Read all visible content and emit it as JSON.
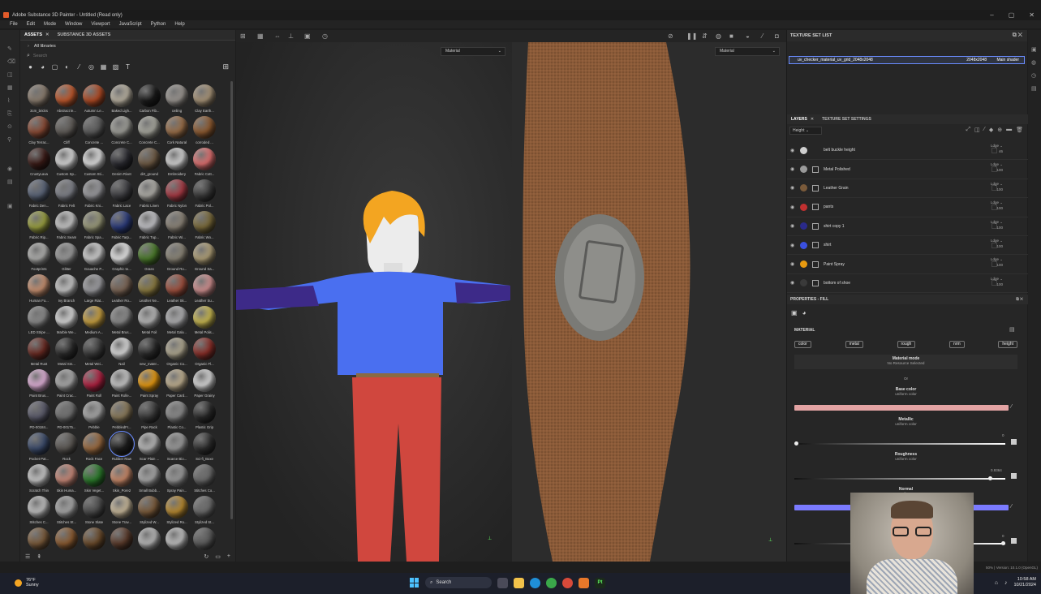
{
  "window": {
    "title": "Adobe Substance 3D Painter - Untitled (Read only)",
    "controls": [
      "–",
      "▢",
      "✕"
    ]
  },
  "menu": [
    "File",
    "Edit",
    "Mode",
    "Window",
    "Viewport",
    "JavaScript",
    "Python",
    "Help"
  ],
  "assets": {
    "tabs": [
      "ASSETS",
      "SUBSTANCE 3D ASSETS"
    ],
    "breadcrumb": "All libraries",
    "search_placeholder": "Search",
    "materials": [
      {
        "label": "3cm_bricks",
        "color": "#8a7c6e"
      },
      {
        "label": "Abstract le...",
        "color": "#c0582c"
      },
      {
        "label": "Autumn Le...",
        "color": "#b04a24"
      },
      {
        "label": "Baked Ligh...",
        "color": "#b8b0a0"
      },
      {
        "label": "Carbon Fib...",
        "color": "#1a1a1a"
      },
      {
        "label": "ceiling",
        "color": "#9a9590"
      },
      {
        "label": "Clay Earth...",
        "color": "#a89478"
      },
      {
        "label": "Clay Terrac...",
        "color": "#8a4a34"
      },
      {
        "label": "Cliff",
        "color": "#5e5a56"
      },
      {
        "label": "Concrete ...",
        "color": "#5a5a5a"
      },
      {
        "label": "Concrete C...",
        "color": "#9e9e98"
      },
      {
        "label": "Concrete C...",
        "color": "#a8a89e"
      },
      {
        "label": "Cork Natural",
        "color": "#9a6e48"
      },
      {
        "label": "corroded ...",
        "color": "#8e5a30"
      },
      {
        "label": "CrustyLava",
        "color": "#3a1a16"
      },
      {
        "label": "Custom Sp...",
        "color": "#d8d8d8"
      },
      {
        "label": "Custom Sti...",
        "color": "#e0e0e0"
      },
      {
        "label": "Denim Rivet",
        "color": "#2a2a30"
      },
      {
        "label": "dirt_ground",
        "color": "#6e5a44"
      },
      {
        "label": "Embroidery",
        "color": "#d4d4d4"
      },
      {
        "label": "Fabric Cott...",
        "color": "#e07070"
      },
      {
        "label": "Fabric Den...",
        "color": "#5a6478"
      },
      {
        "label": "Fabric Felt",
        "color": "#7e8088"
      },
      {
        "label": "Fabric Kni...",
        "color": "#9a9a9e"
      },
      {
        "label": "Fabric Lace",
        "color": "#3e3e42"
      },
      {
        "label": "Fabric Linen",
        "color": "#b0aea8"
      },
      {
        "label": "Fabric Nylon",
        "color": "#a83a44"
      },
      {
        "label": "Fabric Pol...",
        "color": "#3a3a3a"
      },
      {
        "label": "Fabric Rip...",
        "color": "#9aa040"
      },
      {
        "label": "Fabric Seam",
        "color": "#c8c8c8"
      },
      {
        "label": "Fabric Spa...",
        "color": "#9a9a7a"
      },
      {
        "label": "Fabric Tarp...",
        "color": "#2a3a7a"
      },
      {
        "label": "Fabric Tup...",
        "color": "#c4c4c8"
      },
      {
        "label": "Fabric Wi...",
        "color": "#8a8276"
      },
      {
        "label": "Fabric Wo...",
        "color": "#7a6a3a"
      },
      {
        "label": "Footprints",
        "color": "#b0b0ae"
      },
      {
        "label": "Glitter",
        "color": "#9a9a9a"
      },
      {
        "label": "Gouache P...",
        "color": "#d0d0d0"
      },
      {
        "label": "Graphic te...",
        "color": "#e8e8e8"
      },
      {
        "label": "Grass",
        "color": "#4a7a2a"
      },
      {
        "label": "Ground Ro...",
        "color": "#8a8476"
      },
      {
        "label": "Ground Sa...",
        "color": "#b0a078"
      },
      {
        "label": "Human Fo...",
        "color": "#c89070"
      },
      {
        "label": "Ivy Branch",
        "color": "#c8c8c8"
      },
      {
        "label": "Large Riat...",
        "color": "#9e9ea2"
      },
      {
        "label": "Leather Ro...",
        "color": "#7a6454"
      },
      {
        "label": "Leather Ne...",
        "color": "#8a7a40"
      },
      {
        "label": "Leather Sk...",
        "color": "#a0503e"
      },
      {
        "label": "Leather Su...",
        "color": "#d09090"
      },
      {
        "label": "LED Stripe ...",
        "color": "#8a8a8a"
      },
      {
        "label": "Marble We...",
        "color": "#d8d8d8"
      },
      {
        "label": "Medium A...",
        "color": "#c8a040"
      },
      {
        "label": "Metal Brus...",
        "color": "#8a8a8a"
      },
      {
        "label": "Metal Foil",
        "color": "#b8b8b8"
      },
      {
        "label": "Metal Galv...",
        "color": "#b0b0b2"
      },
      {
        "label": "Metal Polis...",
        "color": "#c8b850"
      },
      {
        "label": "Metal Rust",
        "color": "#6a2a22"
      },
      {
        "label": "Metal Sm...",
        "color": "#2a2a2a"
      },
      {
        "label": "Metal Wei...",
        "color": "#3a3a3a"
      },
      {
        "label": "Nail",
        "color": "#dcdcdc"
      },
      {
        "label": "new_mater...",
        "color": "#2a2a2a"
      },
      {
        "label": "Organic Co...",
        "color": "#b0a890"
      },
      {
        "label": "Organic Fl...",
        "color": "#8a2e28"
      },
      {
        "label": "Paint Brus...",
        "color": "#e0b0d8"
      },
      {
        "label": "Paint Crac...",
        "color": "#aaaaaa"
      },
      {
        "label": "Paint Roll",
        "color": "#b02040"
      },
      {
        "label": "Paint Rolle...",
        "color": "#c8c8c8"
      },
      {
        "label": "Paint Spray",
        "color": "#e89a10"
      },
      {
        "label": "Paper Card...",
        "color": "#c0b090"
      },
      {
        "label": "Paper Grainy",
        "color": "#d8d8d8"
      },
      {
        "label": "PD-00184...",
        "color": "#5a5a6a"
      },
      {
        "label": "PD-00175...",
        "color": "#707070"
      },
      {
        "label": "Pebble",
        "color": "#a8a8a8"
      },
      {
        "label": "PebbledFr...",
        "color": "#8a7a5a"
      },
      {
        "label": "Pipe Rack",
        "color": "#3a3a3a"
      },
      {
        "label": "Plastic Co...",
        "color": "#8a8a8a"
      },
      {
        "label": "Plastic Grip",
        "color": "#2a2a2a"
      },
      {
        "label": "Pocket Pat...",
        "color": "#3a4a6a"
      },
      {
        "label": "Rock",
        "color": "#5a5652"
      },
      {
        "label": "Rock Face",
        "color": "#9a6a40"
      },
      {
        "label": "Rubber Raw",
        "color": "#1e1e1e"
      },
      {
        "label": "Scar Plain ...",
        "color": "#b8b8b8"
      },
      {
        "label": "Scarce Bio...",
        "color": "#9a9a9a"
      },
      {
        "label": "Sci-fi_Boxe",
        "color": "#2e2e2e"
      },
      {
        "label": "Scratch Thin",
        "color": "#c8c8c8"
      },
      {
        "label": "Skin Huma...",
        "color": "#c88878"
      },
      {
        "label": "Skin Veget...",
        "color": "#2a7a2a"
      },
      {
        "label": "Skin_Pore2",
        "color": "#c88868"
      },
      {
        "label": "Small Bubb...",
        "color": "#a8a8a8"
      },
      {
        "label": "Spray Pain...",
        "color": "#9a9a9a"
      },
      {
        "label": "Stitches Co...",
        "color": "#6a6a6a"
      },
      {
        "label": "Stitches C...",
        "color": "#c0c0c0"
      },
      {
        "label": "Stitches St...",
        "color": "#a8a8a8"
      },
      {
        "label": "Stone Slate",
        "color": "#4a4a4a"
      },
      {
        "label": "Stone Trav...",
        "color": "#c8b89a"
      },
      {
        "label": "Stylized W...",
        "color": "#7a5a3a"
      },
      {
        "label": "Stylized Ro...",
        "color": "#b88a30"
      },
      {
        "label": "Stylized St...",
        "color": "#6a6a6a"
      },
      {
        "label": "",
        "color": "#7a5a3a"
      },
      {
        "label": "",
        "color": "#8a5a30"
      },
      {
        "label": "",
        "color": "#6a4a2a"
      },
      {
        "label": "",
        "color": "#5a3a2a"
      },
      {
        "label": "",
        "color": "#b8b8b8"
      },
      {
        "label": "",
        "color": "#c0c0c0"
      },
      {
        "label": "",
        "color": "#5a5a5a"
      }
    ],
    "selected_index": 80
  },
  "viewport": {
    "left_select": "Material",
    "right_select": "Material"
  },
  "texture_set_list": {
    "title": "TEXTURE SET LIST",
    "item_name": "uv_checker_material_uv_grid_2048x2048",
    "item_res": "2048x2048",
    "item_shader": "Main shader"
  },
  "layers": {
    "tabs": [
      "LAYERS",
      "TEXTURE SET SETTINGS"
    ],
    "channel": "Height",
    "items": [
      {
        "name": "belt buckle height",
        "blend": "Ldge",
        "opacity": "46",
        "color": "#cfcfcf",
        "mask": false
      },
      {
        "name": "Metal Polished",
        "blend": "Ldge",
        "opacity": "100",
        "color": "#9a9a9a",
        "mask": true
      },
      {
        "name": "Leather Grain",
        "blend": "Ldge",
        "opacity": "100",
        "color": "#7a5a3a",
        "mask": true
      },
      {
        "name": "pants",
        "blend": "Ldge",
        "opacity": "100",
        "color": "#c03030",
        "mask": true
      },
      {
        "name": "shirt copy 1",
        "blend": "Ldge",
        "opacity": "100",
        "color": "#2a2a8a",
        "mask": true
      },
      {
        "name": "shirt",
        "blend": "Ldge",
        "opacity": "100",
        "color": "#3a50e0",
        "mask": true
      },
      {
        "name": "Paint Spray",
        "blend": "Ldge",
        "opacity": "100",
        "color": "#e89a10",
        "mask": true
      },
      {
        "name": "bottom of shoe",
        "blend": "Ldge",
        "opacity": "100",
        "color": "#3a3a3a",
        "mask": true
      }
    ]
  },
  "properties": {
    "title": "PROPERTIES - FILL",
    "section": "MATERIAL",
    "chips": [
      "color",
      "metal",
      "rough",
      "nrm",
      "height"
    ],
    "material_mode_title": "Material mode",
    "material_mode_value": "No Resource Selected",
    "or_text": "Or",
    "base_color_title": "Base color",
    "base_color_sub": "uniform color",
    "base_color_hex": "#e3a3a3",
    "metallic_title": "Metallic",
    "metallic_sub": "uniform color",
    "metallic_value": "0",
    "metallic_level": 0.0,
    "roughness_title": "Roughness",
    "roughness_sub": "uniform color",
    "roughness_value": "0.9364",
    "roughness_level": 0.9364,
    "normal_title": "Normal",
    "normal_sub": "uniform",
    "normal_hex": "#7b7bff",
    "height_value": "0",
    "height_level": 1.0
  },
  "status": {
    "text": "50% | Version: 10.1.0 (OpenGL)"
  },
  "taskbar": {
    "temp": "76°F",
    "weather": "Sunny",
    "search": "Search",
    "time": "10:58 AM",
    "date": "10/21/2024"
  }
}
